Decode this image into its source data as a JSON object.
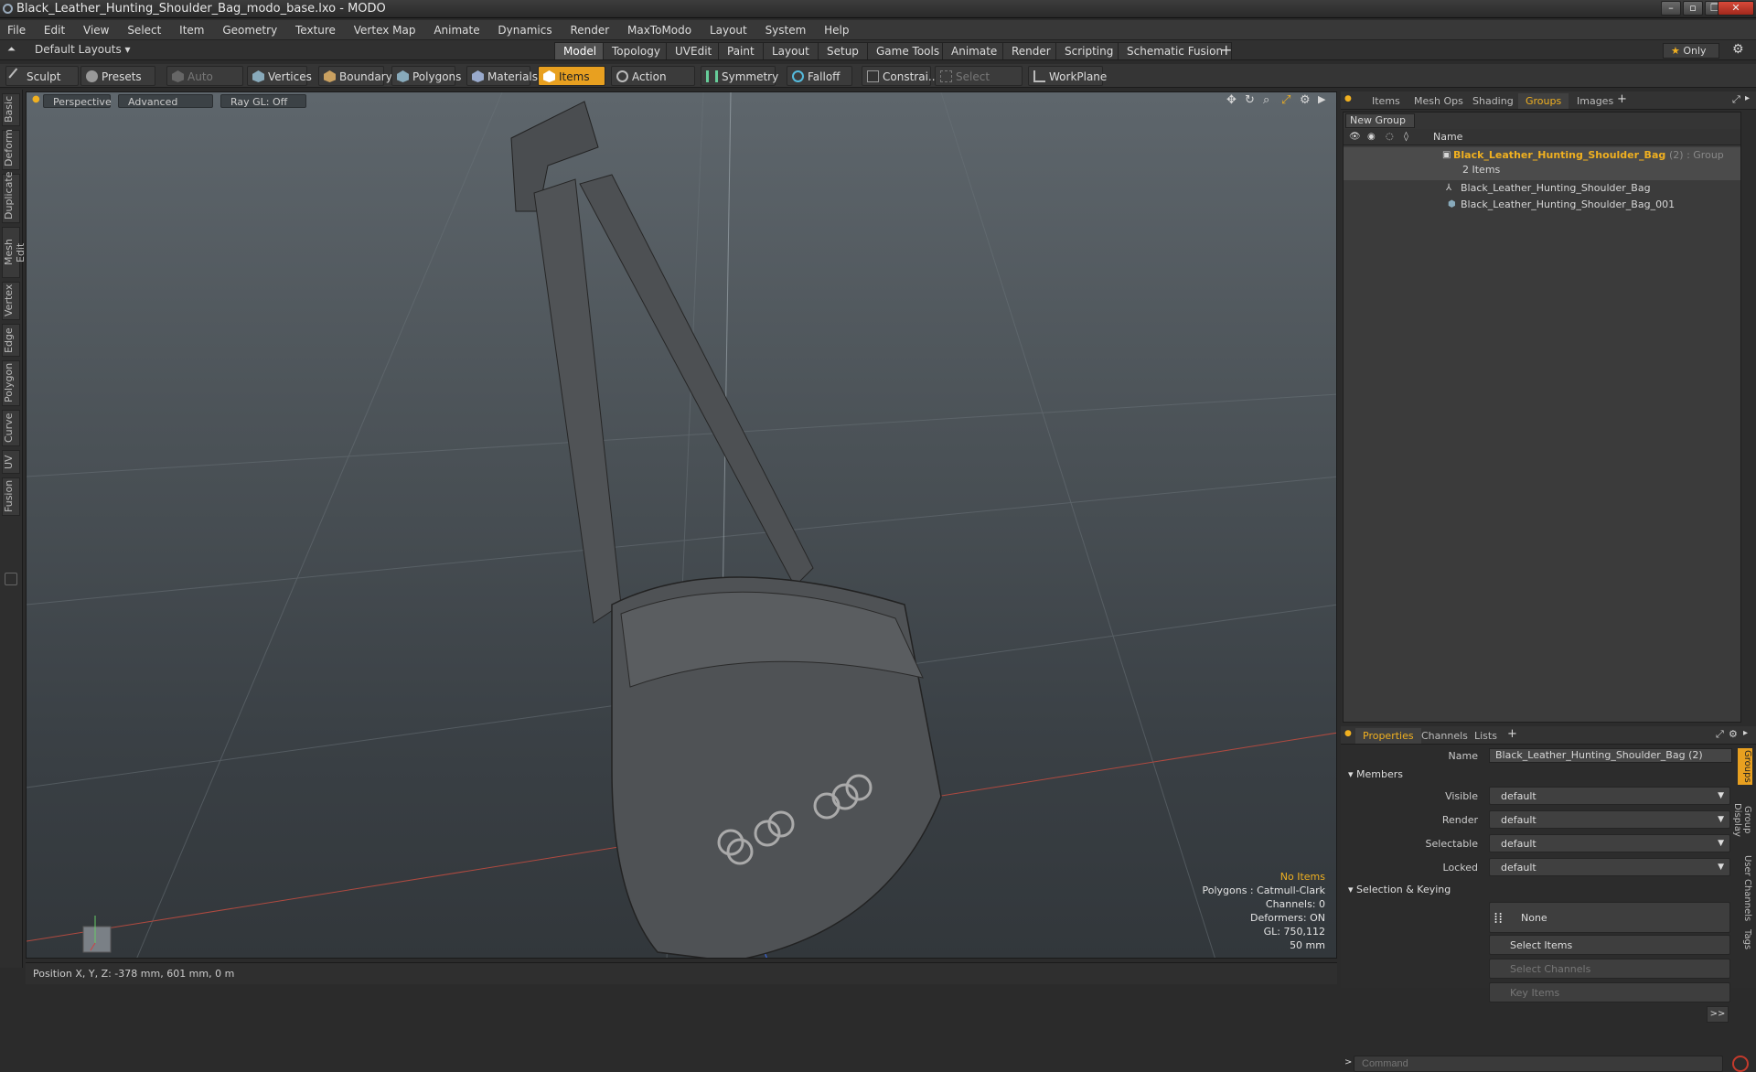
{
  "window": {
    "title": "Black_Leather_Hunting_Shoulder_Bag_modo_base.lxo - MODO"
  },
  "menu": [
    "File",
    "Edit",
    "View",
    "Select",
    "Item",
    "Geometry",
    "Texture",
    "Vertex Map",
    "Animate",
    "Dynamics",
    "Render",
    "MaxToModo",
    "Layout",
    "System",
    "Help"
  ],
  "layoutbar": {
    "default_layouts": "Default Layouts",
    "tabs": [
      "Model",
      "Topology",
      "UVEdit",
      "Paint",
      "Layout",
      "Setup",
      "Game Tools",
      "Animate",
      "Render",
      "Scripting",
      "Schematic Fusion"
    ],
    "active_tab": "Model",
    "only_label": "Only"
  },
  "toolbar": {
    "sculpt": "Sculpt",
    "presets": "Presets",
    "auto_select": "Auto Select",
    "vertices": "Vertices",
    "boundary": "Boundary",
    "polygons": "Polygons",
    "materials": "Materials",
    "items": "Items",
    "action_center": "Action Center",
    "symmetry": "Symmetry",
    "falloff": "Falloff",
    "constraints": "Constrai...",
    "select_through": "Select Through",
    "workplane": "WorkPlane"
  },
  "left_tabs": [
    "Basic",
    "Deform",
    "Duplicate",
    "Mesh Edit",
    "Vertex",
    "Edge",
    "Polygon",
    "Curve",
    "UV",
    "Fusion"
  ],
  "viewport": {
    "view_mode": "Perspective",
    "shading": "Advanced",
    "raygl": "Ray GL: Off",
    "info": {
      "no_items": "No Items",
      "polygons": "Polygons : Catmull-Clark",
      "channels": "Channels: 0",
      "deformers": "Deformers: ON",
      "gl": "GL: 750,112",
      "scale": "50 mm"
    }
  },
  "status": {
    "position": "Position X, Y, Z:  -378 mm, 601 mm, 0 m"
  },
  "right_panel": {
    "top_tabs": [
      "Items",
      "Mesh Ops",
      "Shading",
      "Groups",
      "Images"
    ],
    "active_top_tab": "Groups",
    "new_group": "New Group",
    "column_name": "Name",
    "group": {
      "name": "Black_Leather_Hunting_Shoulder_Bag",
      "suffix": "(2) : Group",
      "count": "2 Items"
    },
    "members": [
      "Black_Leather_Hunting_Shoulder_Bag",
      "Black_Leather_Hunting_Shoulder_Bag_001"
    ],
    "prop_tabs": [
      "Properties",
      "Channels",
      "Lists"
    ],
    "active_prop_tab": "Properties",
    "props": {
      "name_label": "Name",
      "name_value": "Black_Leather_Hunting_Shoulder_Bag (2)",
      "members_section": "Members",
      "visible_label": "Visible",
      "visible_value": "default",
      "render_label": "Render",
      "render_value": "default",
      "selectable_label": "Selectable",
      "selectable_value": "default",
      "locked_label": "Locked",
      "locked_value": "default",
      "sel_section": "Selection & Keying",
      "none_btn": "None",
      "select_items": "Select Items",
      "select_channels": "Select Channels",
      "key_items": "Key Items",
      "more": ">>"
    },
    "side_tabs": [
      "Groups",
      "Group Display",
      "User Channels",
      "Tags"
    ],
    "command_placeholder": "Command"
  },
  "colors": {
    "accent": "#f0b020",
    "close": "#c43a2c"
  }
}
